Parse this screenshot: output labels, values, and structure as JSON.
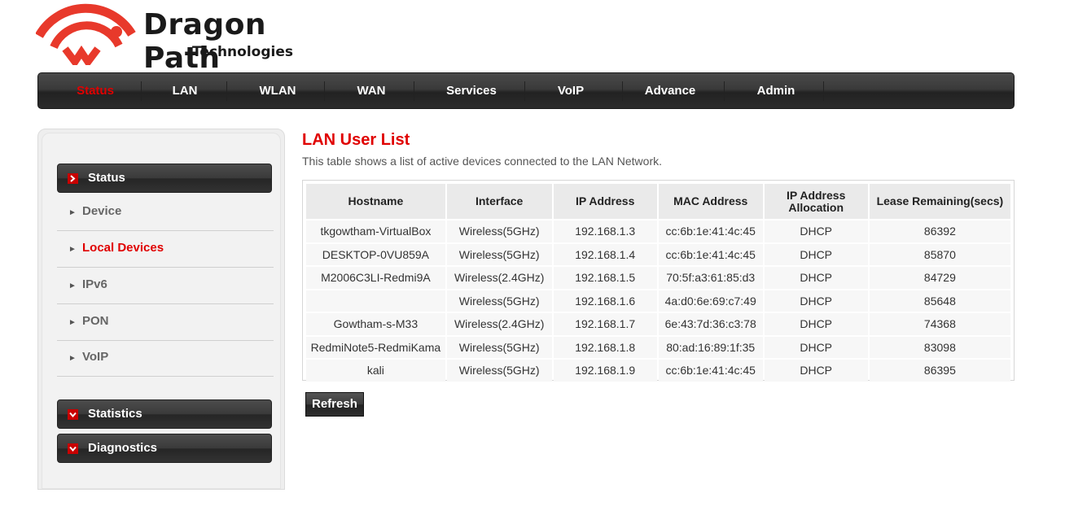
{
  "brand": {
    "name": "Dragon Path",
    "subtitle": "Technologies",
    "logo_color": "#e8392b"
  },
  "topnav": {
    "items": [
      {
        "label": "Status",
        "active": true
      },
      {
        "label": "LAN"
      },
      {
        "label": "WLAN"
      },
      {
        "label": "WAN"
      },
      {
        "label": "Services"
      },
      {
        "label": "VoIP"
      },
      {
        "label": "Advance"
      },
      {
        "label": "Admin"
      }
    ]
  },
  "sidebar": {
    "status_label": "Status",
    "items": [
      {
        "label": "Device"
      },
      {
        "label": "Local Devices",
        "active": true
      },
      {
        "label": "IPv6"
      },
      {
        "label": "PON"
      },
      {
        "label": "VoIP"
      }
    ],
    "statistics_label": "Statistics",
    "diagnostics_label": "Diagnostics"
  },
  "main": {
    "title": "LAN User List",
    "description": "This table shows a list of active devices connected to the LAN Network.",
    "refresh_label": "Refresh"
  },
  "table": {
    "headers": [
      "Hostname",
      "Interface",
      "IP Address",
      "MAC Address",
      "IP Address\nAllocation",
      "Lease Remaining(secs)"
    ],
    "rows": [
      [
        "tkgowtham-VirtualBox",
        "Wireless(5GHz)",
        "192.168.1.3",
        "cc:6b:1e:41:4c:45",
        "DHCP",
        "86392"
      ],
      [
        "DESKTOP-0VU859A",
        "Wireless(5GHz)",
        "192.168.1.4",
        "cc:6b:1e:41:4c:45",
        "DHCP",
        "85870"
      ],
      [
        "M2006C3LI-Redmi9A",
        "Wireless(2.4GHz)",
        "192.168.1.5",
        "70:5f:a3:61:85:d3",
        "DHCP",
        "84729"
      ],
      [
        "",
        "Wireless(5GHz)",
        "192.168.1.6",
        "4a:d0:6e:69:c7:49",
        "DHCP",
        "85648"
      ],
      [
        "Gowtham-s-M33",
        "Wireless(2.4GHz)",
        "192.168.1.7",
        "6e:43:7d:36:c3:78",
        "DHCP",
        "74368"
      ],
      [
        "RedmiNote5-RedmiKama",
        "Wireless(5GHz)",
        "192.168.1.8",
        "80:ad:16:89:1f:35",
        "DHCP",
        "83098"
      ],
      [
        "kali",
        "Wireless(5GHz)",
        "192.168.1.9",
        "cc:6b:1e:41:4c:45",
        "DHCP",
        "86395"
      ]
    ]
  }
}
